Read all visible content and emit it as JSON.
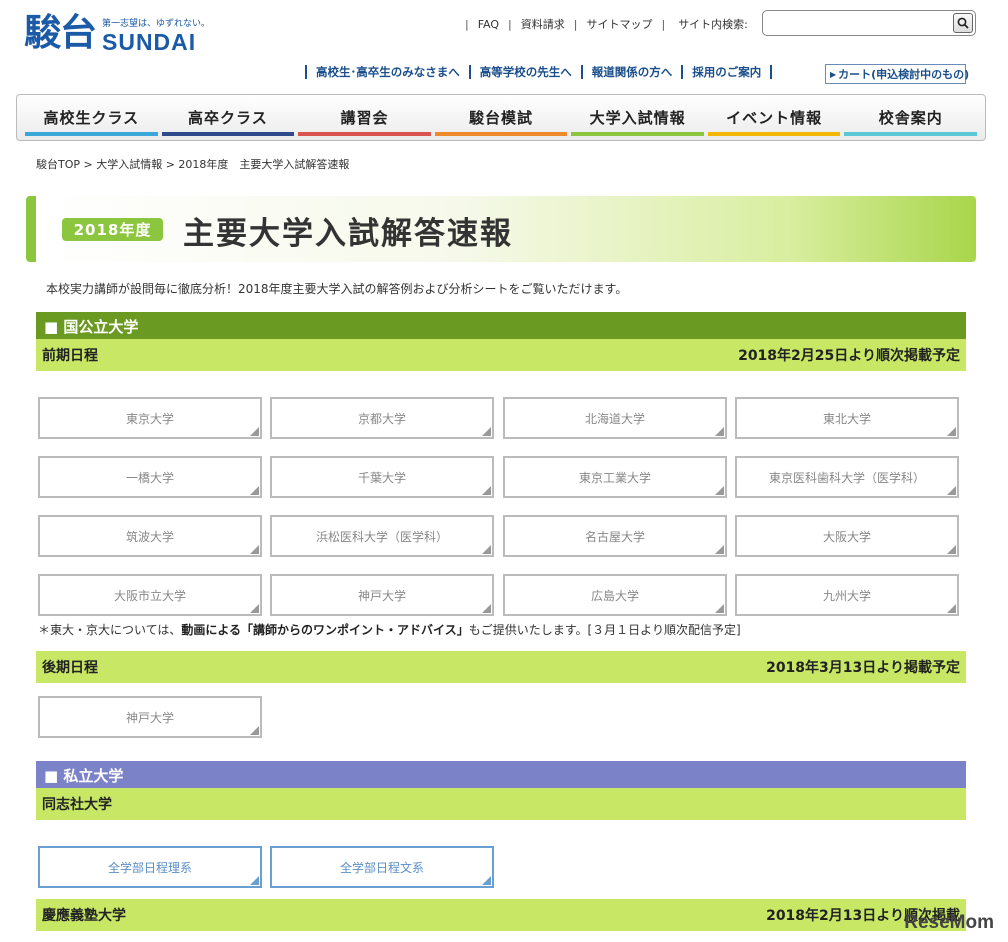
{
  "logo": {
    "kanji": "駿台",
    "tagline": "第一志望は、ゆずれない。",
    "en": "SUNDAI"
  },
  "util_nav": {
    "faq": "FAQ",
    "request": "資料請求",
    "sitemap": "サイトマップ",
    "search_label": "サイト内検索:",
    "search_value": ""
  },
  "audience_nav": [
    "高校生･高卒生のみなさまへ",
    "高等学校の先生へ",
    "報道関係の方へ",
    "採用のご案内"
  ],
  "cart": "カート(申込検討中のもの)",
  "main_nav": [
    {
      "label": "高校生クラス",
      "color": "#3aa7d8"
    },
    {
      "label": "高卒クラス",
      "color": "#2e4a8a"
    },
    {
      "label": "講習会",
      "color": "#d9534f"
    },
    {
      "label": "駿台模試",
      "color": "#ef8a2c"
    },
    {
      "label": "大学入試情報",
      "color": "#8cc63f"
    },
    {
      "label": "イベント情報",
      "color": "#f2b705"
    },
    {
      "label": "校舎案内",
      "color": "#5bc8d8"
    }
  ],
  "breadcrumb": "駿台TOP > 大学入試情報 > 2018年度　主要大学入試解答速報",
  "banner": {
    "year": "2018年度",
    "title": "主要大学入試解答速報"
  },
  "intro": "本校実力講師が設問毎に徹底分析！2018年度主要大学入試の解答例および分析シートをご覧いただけます。",
  "national": {
    "heading": "■ 国公立大学",
    "color": "#6a9a22",
    "zenki": {
      "label": "前期日程",
      "schedule": "2018年2月25日より順次掲載予定",
      "universities": [
        "東京大学",
        "京都大学",
        "北海道大学",
        "東北大学",
        "一橋大学",
        "千葉大学",
        "東京工業大学",
        "東京医科歯科大学（医学科）",
        "筑波大学",
        "浜松医科大学（医学科）",
        "名古屋大学",
        "大阪大学",
        "大阪市立大学",
        "神戸大学",
        "広島大学",
        "九州大学"
      ]
    },
    "note_pre": "＊東大・京大については、",
    "note_bold": "動画による「講師からのワンポイント・アドバイス」",
    "note_post": "もご提供いたします。[３月１日より順次配信予定]",
    "koki": {
      "label": "後期日程",
      "schedule": "2018年3月13日より掲載予定",
      "universities": [
        "神戸大学"
      ]
    }
  },
  "private": {
    "heading": "■ 私立大学",
    "color": "#7b82c8",
    "doshisha": {
      "label": "同志社大学",
      "buttons": [
        "全学部日程理系",
        "全学部日程文系"
      ]
    },
    "keio": {
      "label": "慶應義塾大学",
      "schedule": "2018年2月13日より順次掲載"
    }
  },
  "watermark": "ReseMom"
}
